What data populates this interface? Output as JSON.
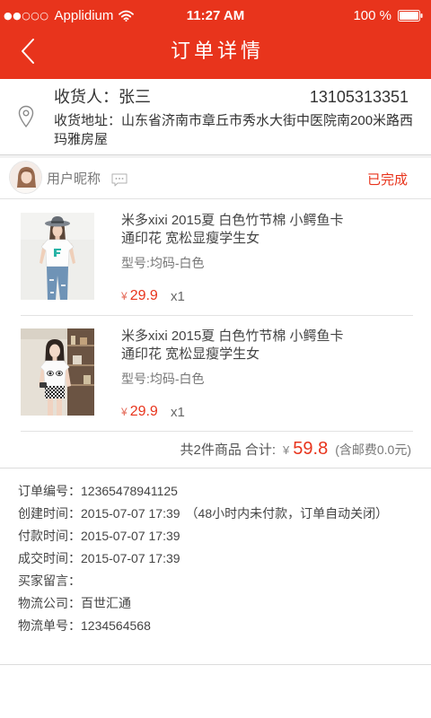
{
  "status_bar": {
    "signal": "●●○○○",
    "carrier": "Applidium",
    "time": "11:27 AM",
    "battery": "100 %",
    "icons": [
      "wifi-icon",
      "battery-icon"
    ]
  },
  "nav": {
    "back_icon": "chevron-left-icon",
    "title": "订单详情"
  },
  "address": {
    "icon": "location-pin-icon",
    "receiver_label": "收货人：",
    "receiver_name": "张三",
    "phone": "13105313351",
    "address_label": "收货地址：",
    "address_text": "山东省济南市章丘市秀水大街中医院南200米路西玛雅房屋"
  },
  "shop": {
    "nickname": "用户昵称",
    "chat_icon": "chat-bubble-icon",
    "status": "已完成"
  },
  "items": [
    {
      "title": "米多xixi 2015夏 白色竹节棉 小鳄鱼卡通印花 宽松显瘦学生女",
      "spec": "型号:均码-白色",
      "currency": "¥",
      "price": "29.9",
      "qty": "x1"
    },
    {
      "title": "米多xixi 2015夏 白色竹节棉 小鳄鱼卡通印花 宽松显瘦学生女",
      "spec": "型号:均码-白色",
      "currency": "¥",
      "price": "29.9",
      "qty": "x1"
    }
  ],
  "summary": {
    "count_text": "共2件商品",
    "total_label": "合计:",
    "currency": "¥",
    "total": "59.8",
    "shipping_note": "(含邮费0.0元)"
  },
  "order_info": [
    {
      "label": "订单编号：",
      "value": "12365478941125"
    },
    {
      "label": "创建时间：",
      "value": "2015-07-07 17:39",
      "note": "（48小时内未付款，订单自动关闭）"
    },
    {
      "label": "付款时间：",
      "value": "2015-07-07 17:39"
    },
    {
      "label": "成交时间：",
      "value": "2015-07-07 17:39"
    },
    {
      "label": "买家留言："
    },
    {
      "label": "物流公司：",
      "value": "百世汇通"
    },
    {
      "label": "物流单号：",
      "value": "1234564568"
    }
  ],
  "colors": {
    "accent": "#e8341c",
    "text": "#333333",
    "muted": "#777777"
  }
}
